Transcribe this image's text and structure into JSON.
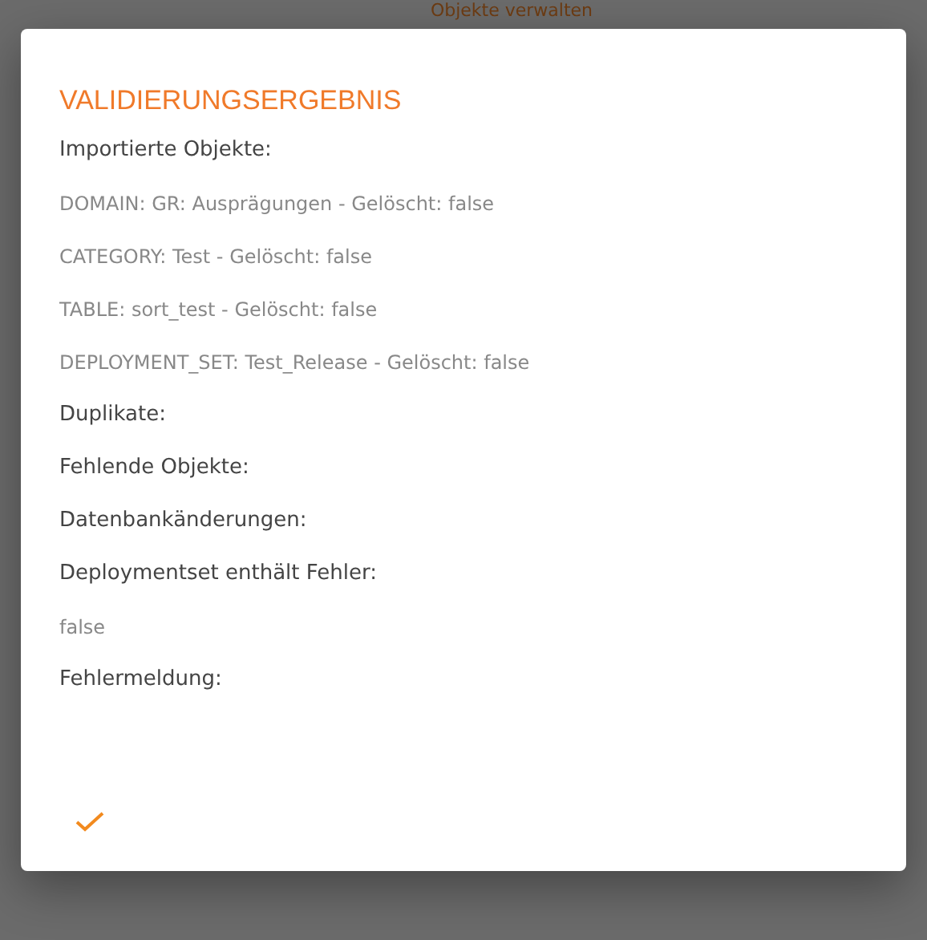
{
  "background": {
    "heading": "Objekte verwalten"
  },
  "dialog": {
    "title": "VALIDIERUNGSERGEBNIS",
    "sections": [
      {
        "label": "Importierte Objekte:",
        "items": [
          "DOMAIN: GR: Ausprägungen - Gelöscht: false",
          "CATEGORY: Test - Gelöscht: false",
          "TABLE: sort_test - Gelöscht: false",
          "DEPLOYMENT_SET: Test_Release - Gelöscht: false"
        ]
      },
      {
        "label": "Duplikate:"
      },
      {
        "label": "Fehlende Objekte:"
      },
      {
        "label": "Datenbankänderungen:"
      },
      {
        "label": "Deploymentset enthält Fehler:",
        "items": [
          "false"
        ]
      },
      {
        "label": "Fehlermeldung:"
      }
    ],
    "confirm": {
      "kind": "check"
    }
  }
}
